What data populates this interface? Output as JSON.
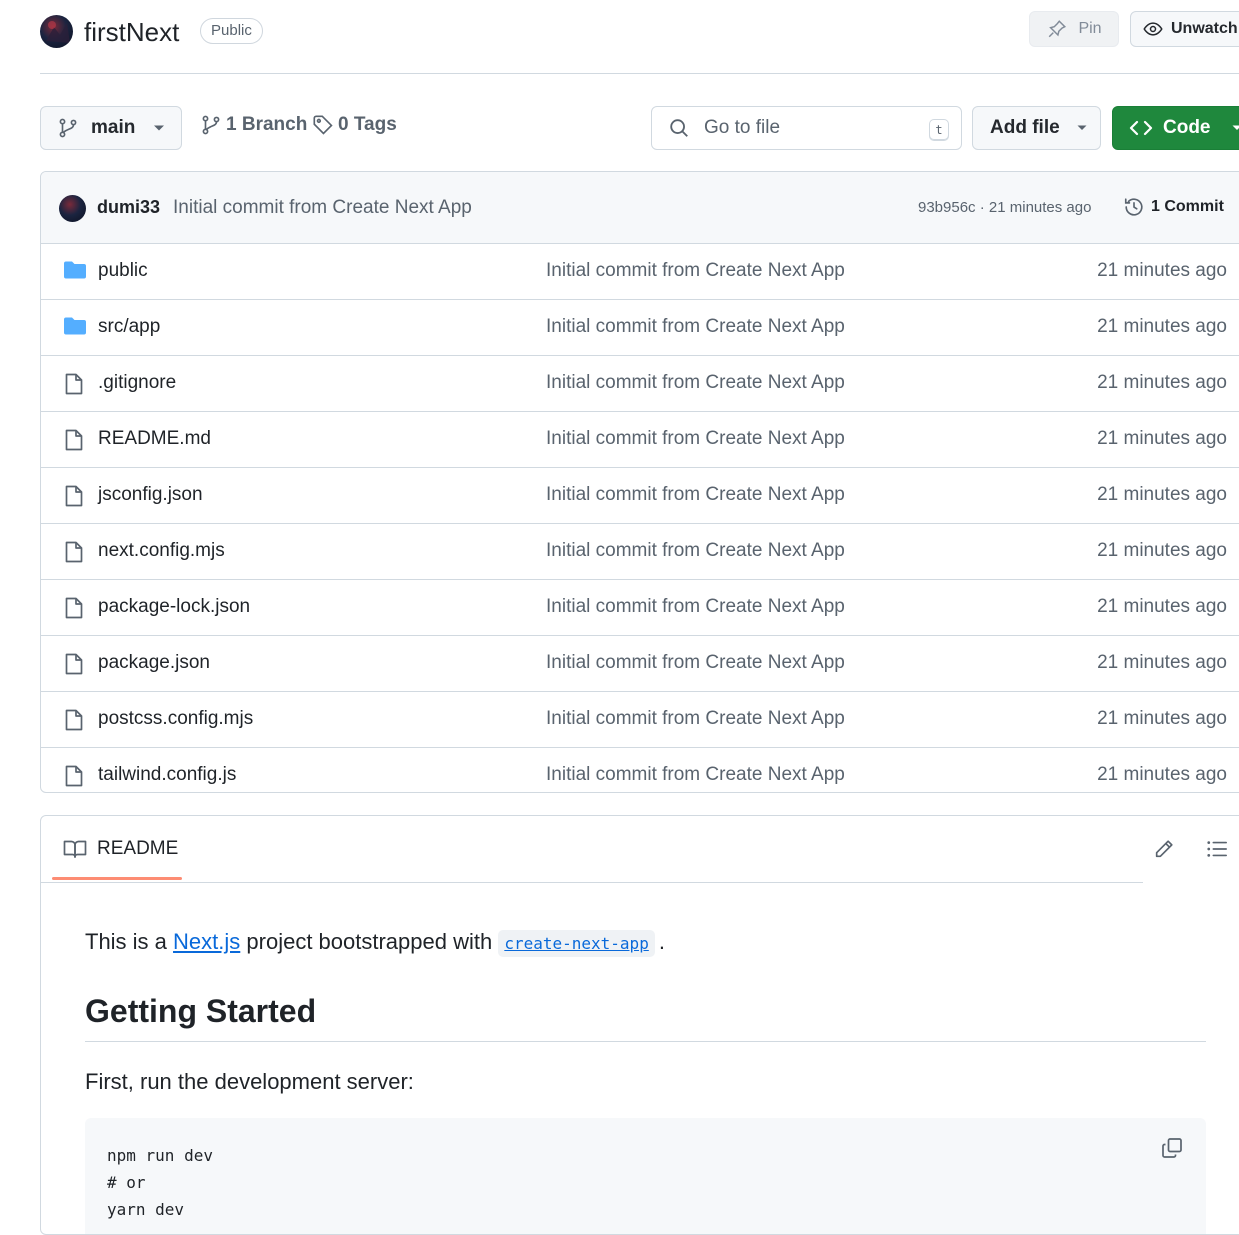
{
  "repo": {
    "name": "firstNext",
    "visibility": "Public"
  },
  "header_actions": {
    "pin_label": "Pin",
    "unwatch_label": "Unwatch"
  },
  "toolbar": {
    "branch": "main",
    "branches_label": "1 Branch",
    "tags_label": "0 Tags",
    "goto_placeholder": "Go to file",
    "goto_shortcut": "t",
    "add_file_label": "Add file",
    "code_label": "Code"
  },
  "latest_commit": {
    "author": "dumi33",
    "message": "Initial commit from Create Next App",
    "meta": "93b956c · 21 minutes ago",
    "count_label": "1 Commit"
  },
  "files": [
    {
      "name": "public",
      "type": "folder",
      "message": "Initial commit from Create Next App",
      "time": "21 minutes ago"
    },
    {
      "name": "src/app",
      "type": "folder",
      "message": "Initial commit from Create Next App",
      "time": "21 minutes ago"
    },
    {
      "name": ".gitignore",
      "type": "file",
      "message": "Initial commit from Create Next App",
      "time": "21 minutes ago"
    },
    {
      "name": "README.md",
      "type": "file",
      "message": "Initial commit from Create Next App",
      "time": "21 minutes ago"
    },
    {
      "name": "jsconfig.json",
      "type": "file",
      "message": "Initial commit from Create Next App",
      "time": "21 minutes ago"
    },
    {
      "name": "next.config.mjs",
      "type": "file",
      "message": "Initial commit from Create Next App",
      "time": "21 minutes ago"
    },
    {
      "name": "package-lock.json",
      "type": "file",
      "message": "Initial commit from Create Next App",
      "time": "21 minutes ago"
    },
    {
      "name": "package.json",
      "type": "file",
      "message": "Initial commit from Create Next App",
      "time": "21 minutes ago"
    },
    {
      "name": "postcss.config.mjs",
      "type": "file",
      "message": "Initial commit from Create Next App",
      "time": "21 minutes ago"
    },
    {
      "name": "tailwind.config.js",
      "type": "file",
      "message": "Initial commit from Create Next App",
      "time": "21 minutes ago"
    }
  ],
  "readme": {
    "tab_label": "README",
    "intro_prefix": "This is a ",
    "intro_link": "Next.js",
    "intro_middle": " project bootstrapped with ",
    "intro_code": "create-next-app",
    "intro_suffix": ".",
    "heading": "Getting Started",
    "paragraph": "First, run the development server:",
    "code_lines": [
      "npm run dev",
      "# or",
      "yarn dev"
    ]
  },
  "colors": {
    "primary_button": "#1f883d",
    "link": "#0969da",
    "folder_icon": "#54aeff",
    "tab_underline": "#fd8c73"
  }
}
